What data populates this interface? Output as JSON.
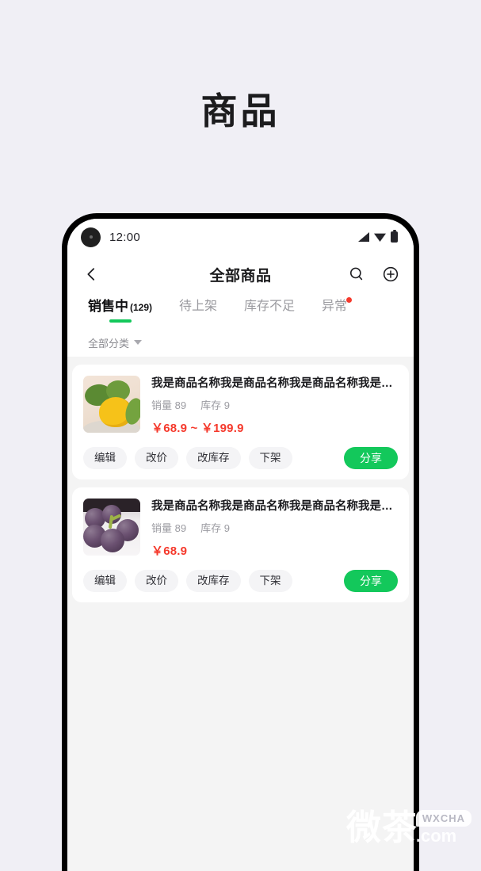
{
  "page": {
    "title": "商品",
    "background_color": "#f0eff5"
  },
  "watermark": {
    "text_cn": "微茶",
    "badge": "WXCHA",
    "domain": ".com"
  },
  "phone": {
    "status_bar": {
      "time": "12:00",
      "icons": [
        "signal-icon",
        "wifi-icon",
        "battery-icon"
      ]
    },
    "nav": {
      "back_icon": "chevron-left-icon",
      "title": "全部商品",
      "search_icon": "search-icon",
      "add_icon": "plus-circle-icon"
    },
    "tabs": [
      {
        "label": "销售中",
        "count": "(129)",
        "active": true,
        "badge": false
      },
      {
        "label": "待上架",
        "count": "",
        "active": false,
        "badge": false
      },
      {
        "label": "库存不足",
        "count": "",
        "active": false,
        "badge": false
      },
      {
        "label": "异常",
        "count": "",
        "active": false,
        "badge": true
      }
    ],
    "filter": {
      "label": "全部分类",
      "caret_icon": "chevron-down-icon"
    },
    "products": [
      {
        "name": "我是商品名称我是商品名称我是商品名称我是…",
        "sales_label": "销量",
        "sales_value": "89",
        "stock_label": "库存",
        "stock_value": "9",
        "price": "￥68.9 ~ ￥199.9",
        "thumb": "mango-image",
        "actions": [
          "编辑",
          "改价",
          "改库存",
          "下架"
        ],
        "share": "分享"
      },
      {
        "name": "我是商品名称我是商品名称我是商品名称我是…",
        "sales_label": "销量",
        "sales_value": "89",
        "stock_label": "库存",
        "stock_value": "9",
        "price": "￥68.9",
        "thumb": "grape-image",
        "actions": [
          "编辑",
          "改价",
          "改库存",
          "下架"
        ],
        "share": "分享"
      }
    ]
  },
  "colors": {
    "brand_green": "#13c85b",
    "price_red": "#f5392c",
    "badge_red": "#f5392c",
    "screen_bg": "#f4f4f4",
    "card_bg": "#ffffff"
  }
}
